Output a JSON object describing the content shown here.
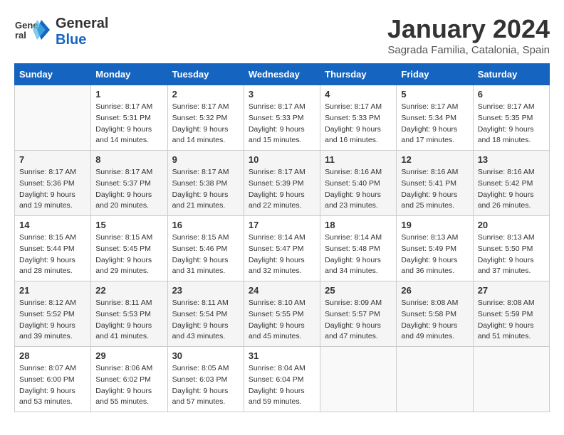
{
  "header": {
    "logo_general": "General",
    "logo_blue": "Blue",
    "month_title": "January 2024",
    "subtitle": "Sagrada Familia, Catalonia, Spain"
  },
  "days_of_week": [
    "Sunday",
    "Monday",
    "Tuesday",
    "Wednesday",
    "Thursday",
    "Friday",
    "Saturday"
  ],
  "weeks": [
    [
      {
        "day": "",
        "empty": true
      },
      {
        "day": "1",
        "sunrise": "Sunrise: 8:17 AM",
        "sunset": "Sunset: 5:31 PM",
        "daylight": "Daylight: 9 hours and 14 minutes."
      },
      {
        "day": "2",
        "sunrise": "Sunrise: 8:17 AM",
        "sunset": "Sunset: 5:32 PM",
        "daylight": "Daylight: 9 hours and 14 minutes."
      },
      {
        "day": "3",
        "sunrise": "Sunrise: 8:17 AM",
        "sunset": "Sunset: 5:33 PM",
        "daylight": "Daylight: 9 hours and 15 minutes."
      },
      {
        "day": "4",
        "sunrise": "Sunrise: 8:17 AM",
        "sunset": "Sunset: 5:33 PM",
        "daylight": "Daylight: 9 hours and 16 minutes."
      },
      {
        "day": "5",
        "sunrise": "Sunrise: 8:17 AM",
        "sunset": "Sunset: 5:34 PM",
        "daylight": "Daylight: 9 hours and 17 minutes."
      },
      {
        "day": "6",
        "sunrise": "Sunrise: 8:17 AM",
        "sunset": "Sunset: 5:35 PM",
        "daylight": "Daylight: 9 hours and 18 minutes."
      }
    ],
    [
      {
        "day": "7",
        "sunrise": "Sunrise: 8:17 AM",
        "sunset": "Sunset: 5:36 PM",
        "daylight": "Daylight: 9 hours and 19 minutes."
      },
      {
        "day": "8",
        "sunrise": "Sunrise: 8:17 AM",
        "sunset": "Sunset: 5:37 PM",
        "daylight": "Daylight: 9 hours and 20 minutes."
      },
      {
        "day": "9",
        "sunrise": "Sunrise: 8:17 AM",
        "sunset": "Sunset: 5:38 PM",
        "daylight": "Daylight: 9 hours and 21 minutes."
      },
      {
        "day": "10",
        "sunrise": "Sunrise: 8:17 AM",
        "sunset": "Sunset: 5:39 PM",
        "daylight": "Daylight: 9 hours and 22 minutes."
      },
      {
        "day": "11",
        "sunrise": "Sunrise: 8:16 AM",
        "sunset": "Sunset: 5:40 PM",
        "daylight": "Daylight: 9 hours and 23 minutes."
      },
      {
        "day": "12",
        "sunrise": "Sunrise: 8:16 AM",
        "sunset": "Sunset: 5:41 PM",
        "daylight": "Daylight: 9 hours and 25 minutes."
      },
      {
        "day": "13",
        "sunrise": "Sunrise: 8:16 AM",
        "sunset": "Sunset: 5:42 PM",
        "daylight": "Daylight: 9 hours and 26 minutes."
      }
    ],
    [
      {
        "day": "14",
        "sunrise": "Sunrise: 8:15 AM",
        "sunset": "Sunset: 5:44 PM",
        "daylight": "Daylight: 9 hours and 28 minutes."
      },
      {
        "day": "15",
        "sunrise": "Sunrise: 8:15 AM",
        "sunset": "Sunset: 5:45 PM",
        "daylight": "Daylight: 9 hours and 29 minutes."
      },
      {
        "day": "16",
        "sunrise": "Sunrise: 8:15 AM",
        "sunset": "Sunset: 5:46 PM",
        "daylight": "Daylight: 9 hours and 31 minutes."
      },
      {
        "day": "17",
        "sunrise": "Sunrise: 8:14 AM",
        "sunset": "Sunset: 5:47 PM",
        "daylight": "Daylight: 9 hours and 32 minutes."
      },
      {
        "day": "18",
        "sunrise": "Sunrise: 8:14 AM",
        "sunset": "Sunset: 5:48 PM",
        "daylight": "Daylight: 9 hours and 34 minutes."
      },
      {
        "day": "19",
        "sunrise": "Sunrise: 8:13 AM",
        "sunset": "Sunset: 5:49 PM",
        "daylight": "Daylight: 9 hours and 36 minutes."
      },
      {
        "day": "20",
        "sunrise": "Sunrise: 8:13 AM",
        "sunset": "Sunset: 5:50 PM",
        "daylight": "Daylight: 9 hours and 37 minutes."
      }
    ],
    [
      {
        "day": "21",
        "sunrise": "Sunrise: 8:12 AM",
        "sunset": "Sunset: 5:52 PM",
        "daylight": "Daylight: 9 hours and 39 minutes."
      },
      {
        "day": "22",
        "sunrise": "Sunrise: 8:11 AM",
        "sunset": "Sunset: 5:53 PM",
        "daylight": "Daylight: 9 hours and 41 minutes."
      },
      {
        "day": "23",
        "sunrise": "Sunrise: 8:11 AM",
        "sunset": "Sunset: 5:54 PM",
        "daylight": "Daylight: 9 hours and 43 minutes."
      },
      {
        "day": "24",
        "sunrise": "Sunrise: 8:10 AM",
        "sunset": "Sunset: 5:55 PM",
        "daylight": "Daylight: 9 hours and 45 minutes."
      },
      {
        "day": "25",
        "sunrise": "Sunrise: 8:09 AM",
        "sunset": "Sunset: 5:57 PM",
        "daylight": "Daylight: 9 hours and 47 minutes."
      },
      {
        "day": "26",
        "sunrise": "Sunrise: 8:08 AM",
        "sunset": "Sunset: 5:58 PM",
        "daylight": "Daylight: 9 hours and 49 minutes."
      },
      {
        "day": "27",
        "sunrise": "Sunrise: 8:08 AM",
        "sunset": "Sunset: 5:59 PM",
        "daylight": "Daylight: 9 hours and 51 minutes."
      }
    ],
    [
      {
        "day": "28",
        "sunrise": "Sunrise: 8:07 AM",
        "sunset": "Sunset: 6:00 PM",
        "daylight": "Daylight: 9 hours and 53 minutes."
      },
      {
        "day": "29",
        "sunrise": "Sunrise: 8:06 AM",
        "sunset": "Sunset: 6:02 PM",
        "daylight": "Daylight: 9 hours and 55 minutes."
      },
      {
        "day": "30",
        "sunrise": "Sunrise: 8:05 AM",
        "sunset": "Sunset: 6:03 PM",
        "daylight": "Daylight: 9 hours and 57 minutes."
      },
      {
        "day": "31",
        "sunrise": "Sunrise: 8:04 AM",
        "sunset": "Sunset: 6:04 PM",
        "daylight": "Daylight: 9 hours and 59 minutes."
      },
      {
        "day": "",
        "empty": true
      },
      {
        "day": "",
        "empty": true
      },
      {
        "day": "",
        "empty": true
      }
    ]
  ]
}
